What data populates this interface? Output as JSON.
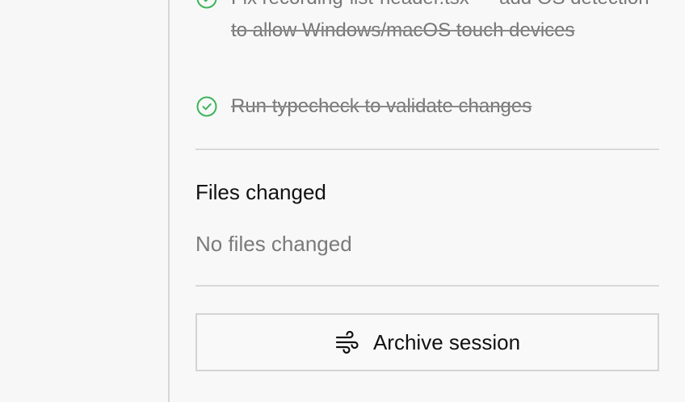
{
  "tasks": [
    {
      "label": "Fix recording-list-header.tsx — add OS detection to allow Windows/macOS touch devices",
      "done": true,
      "icon": "check-circle-icon"
    },
    {
      "label": "Run typecheck to validate changes",
      "done": true,
      "icon": "check-circle-icon"
    }
  ],
  "files": {
    "title": "Files changed",
    "empty_text": "No files changed"
  },
  "archive": {
    "label": "Archive session",
    "icon": "wind-icon"
  },
  "colors": {
    "check": "#3cb45a",
    "muted_text": "#777777",
    "divider": "#d9d9d9",
    "background": "#f8f8f8"
  }
}
